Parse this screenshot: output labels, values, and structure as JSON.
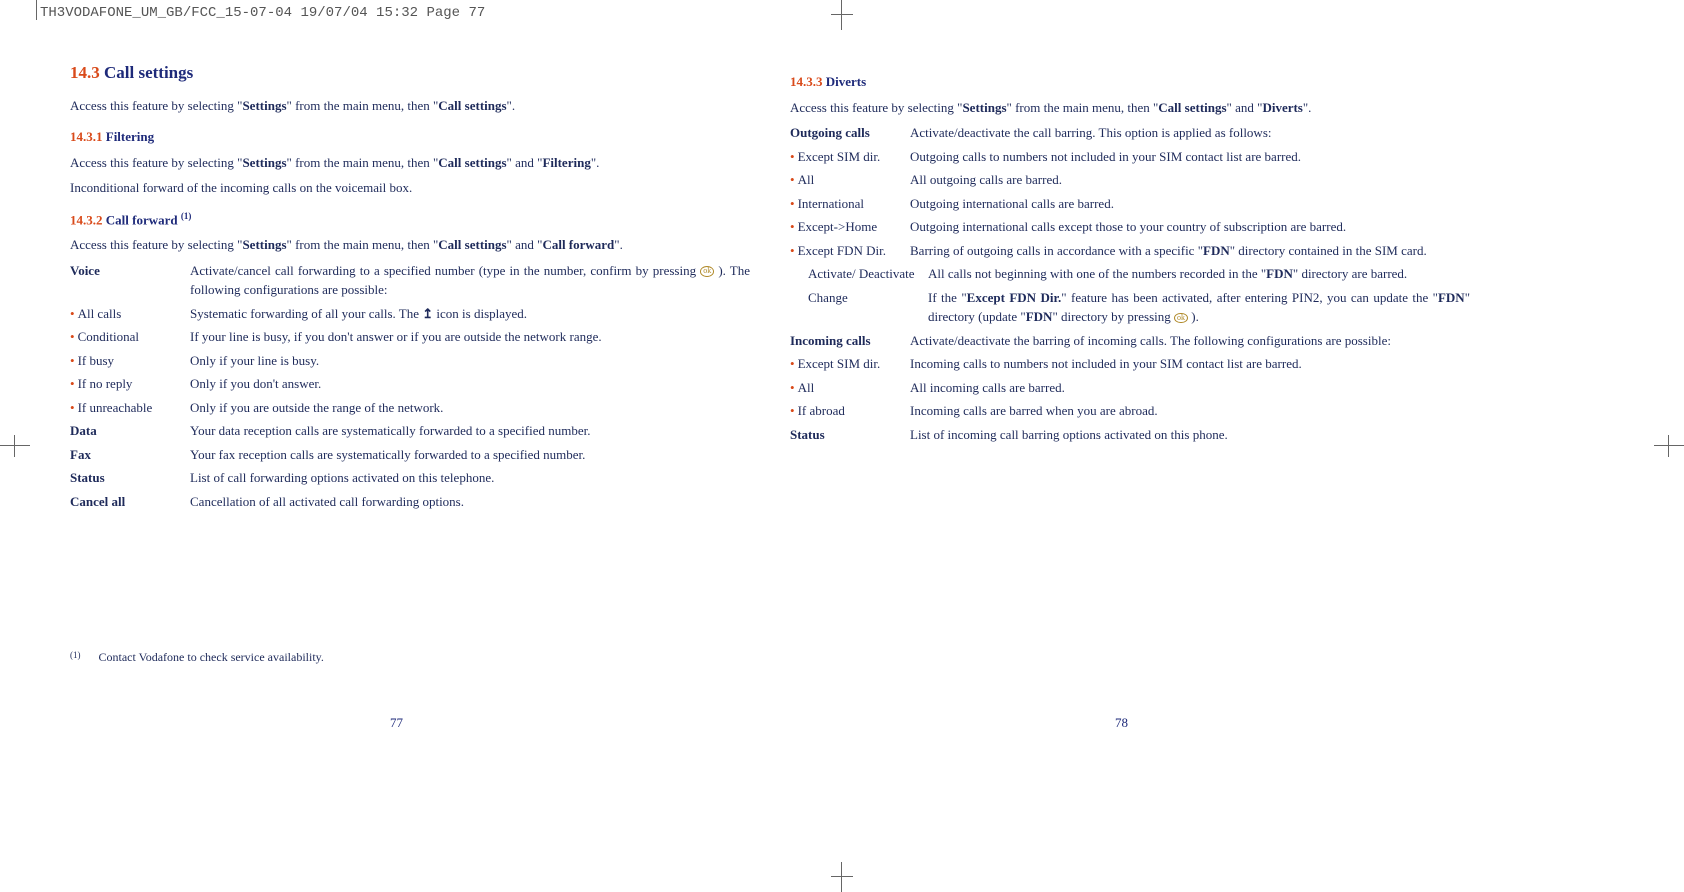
{
  "header": "TH3VODAFONE_UM_GB/FCC_15-07-04  19/07/04  15:32  Page 77",
  "left": {
    "h2_num": "14.3",
    "h2_title": "Call settings",
    "intro_pre": "Access this feature by selecting \"",
    "intro_s1": "Settings",
    "intro_mid": "\" from the main menu, then \"",
    "intro_s2": "Call settings",
    "intro_end": "\".",
    "s1_num": "14.3.1",
    "s1_title": "Filtering",
    "s1_p1_pre": "Access this feature by selecting \"",
    "s1_p1_a": "Settings",
    "s1_p1_mid": "\" from the main menu, then \"",
    "s1_p1_b": "Call settings",
    "s1_p1_mid2": "\" and \"",
    "s1_p1_c": "Filtering",
    "s1_p1_end": "\".",
    "s1_p2": "Inconditional forward of the incoming calls on the voicemail box.",
    "s2_num": "14.3.2",
    "s2_title": "Call forward ",
    "s2_sup": "(1)",
    "s2_p1_pre": "Access this feature by selecting \"",
    "s2_p1_a": "Settings",
    "s2_p1_mid": "\" from the main menu, then \"",
    "s2_p1_b": "Call settings",
    "s2_p1_mid2": "\" and \"",
    "s2_p1_c": "Call forward",
    "s2_p1_end": "\".",
    "rows": {
      "voice_t": "Voice",
      "voice_d1": "Activate/cancel call forwarding to a specified number (type in the number, confirm by pressing ",
      "voice_d2": " ). The following configurations are possible:",
      "allcalls_t": "All calls",
      "allcalls_d1": "Systematic forwarding of all your calls. The ",
      "allcalls_d2": " icon is displayed.",
      "cond_t": "Conditional",
      "cond_d": "If your line is busy, if you don't answer or if you are outside the network range.",
      "busy_t": "If busy",
      "busy_d": "Only if your line is busy.",
      "noreply_t": "If no reply",
      "noreply_d": "Only if you don't answer.",
      "unreach_t": "If unreachable",
      "unreach_d": "Only if you are outside the range of the network.",
      "data_t": "Data",
      "data_d": "Your data reception calls are systematically forwarded to a specified number.",
      "fax_t": "Fax",
      "fax_d": "Your fax reception calls are systematically forwarded to a specified number.",
      "status_t": "Status",
      "status_d": "List of call forwarding options activated on this telephone.",
      "cancel_t": "Cancel all",
      "cancel_d": "Cancellation of all activated call forwarding options."
    }
  },
  "right": {
    "s3_num": "14.3.3",
    "s3_title": "Diverts",
    "s3_p1_pre": "Access this feature by selecting \"",
    "s3_p1_a": "Settings",
    "s3_p1_mid": "\" from the main menu, then \"",
    "s3_p1_b": "Call settings",
    "s3_p1_mid2": "\" and \"",
    "s3_p1_c": "Diverts",
    "s3_p1_end": "\".",
    "rows": {
      "out_t": "Outgoing calls",
      "out_d": "Activate/deactivate the call barring. This option is applied as follows:",
      "sim_t": "Except SIM dir.",
      "sim_d": "Outgoing calls to numbers not included in your SIM contact list are barred.",
      "all_t": "All",
      "all_d": "All outgoing calls are barred.",
      "intl_t": "International",
      "intl_d": "Outgoing international calls are barred.",
      "home_t": "Except->Home",
      "home_d": "Outgoing international calls except those to your country of subscription are barred.",
      "fdn_t": "Except FDN Dir.",
      "fdn_d1": "Barring of outgoing calls in accordance with a specific \"",
      "fdn_b": "FDN",
      "fdn_d2": "\" directory contained in the SIM card.",
      "act_t": "Activate/ Deactivate",
      "act_d1": "All calls not beginning with one of the numbers recorded in the \"",
      "act_b": "FDN",
      "act_d2": "\" directory are barred.",
      "chg_t": "Change",
      "chg_d1": "If the \"",
      "chg_b1": "Except FDN Dir.",
      "chg_d2": "\" feature has been activated, after entering PIN2, you can update the \"",
      "chg_b2": "FDN",
      "chg_d3": "\" directory (update \"",
      "chg_b3": "FDN",
      "chg_d4": "\" directory by pressing ",
      "chg_d5": " ).",
      "in_t": "Incoming calls",
      "in_d": "Activate/deactivate the barring of incoming calls. The following configurations are possible:",
      "isim_t": "Except SIM dir.",
      "isim_d": "Incoming calls to numbers not included in your SIM contact list are barred.",
      "iall_t": "All",
      "iall_d": "All incoming calls are barred.",
      "abroad_t": "If abroad",
      "abroad_d": "Incoming calls are barred when you are abroad.",
      "status_t": "Status",
      "status_d": "List of incoming call barring options activated on this phone."
    }
  },
  "footnote_mark": "(1)",
  "footnote": "Contact Vodafone to check service availability.",
  "pg_left": "77",
  "pg_right": "78",
  "ok_label": "ok",
  "fwd_symbol": "↥"
}
